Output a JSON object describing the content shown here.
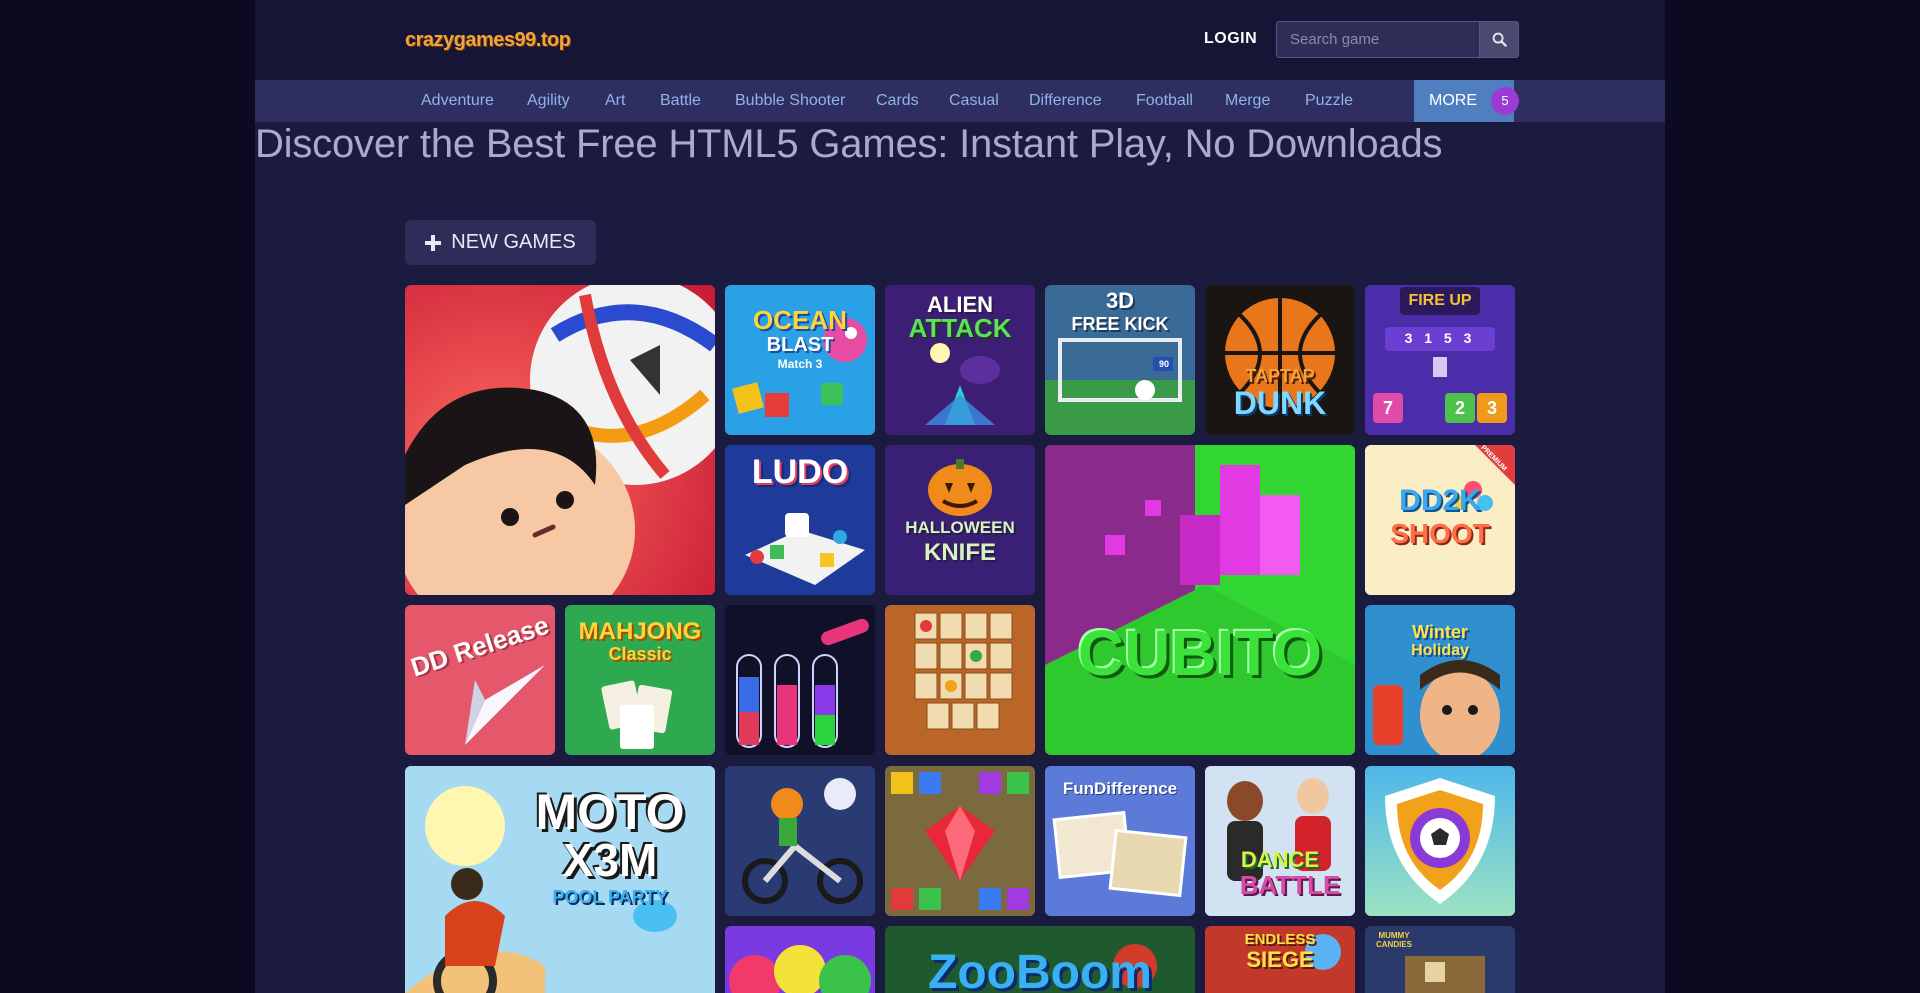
{
  "site": {
    "logo_text": "crazygames99.top"
  },
  "header": {
    "login_label": "LOGIN",
    "search_placeholder": "Search game"
  },
  "nav": {
    "items": [
      "Adventure",
      "Agility",
      "Art",
      "Battle",
      "Bubble Shooter",
      "Cards",
      "Casual",
      "Difference",
      "Football",
      "Merge",
      "Puzzle"
    ],
    "more_label": "MORE",
    "more_count": "5"
  },
  "hero": {
    "title": "Discover the Best Free HTML5 Games: Instant Play, No Downloads"
  },
  "section": {
    "new_games_label": "NEW GAMES"
  },
  "tiles": {
    "ocean_blast": {
      "line1": "OCEAN",
      "line2": "BLAST",
      "line3": "Match 3"
    },
    "alien_attack": {
      "line1": "ALIEN",
      "line2": "ATTACK"
    },
    "free_kick": {
      "line1": "3D",
      "line2": "FREE KICK",
      "score": "90"
    },
    "taptap_dunk": {
      "line1": "TAPTAP",
      "line2": "DUNK"
    },
    "fire_up": {
      "title": "FIRE UP",
      "nums_top": "3 1 5 3",
      "n1": "7",
      "n2": "2",
      "n3": "3"
    },
    "ludo": {
      "title": "LUDO"
    },
    "halloween_knife": {
      "line1": "HALLOWEEN",
      "line2": "KNIFE"
    },
    "cubito": {
      "title": "CUBITO"
    },
    "dd2k_shoot": {
      "line1": "DD2K",
      "line2": "SHOOT",
      "ribbon": "PREMIUM"
    },
    "dd_release": {
      "title": "DD Release"
    },
    "mahjong": {
      "line1": "MAHJONG",
      "line2": "Classic"
    },
    "winter_holiday": {
      "line1": "Winter",
      "line2": "Holiday"
    },
    "moto_x3m": {
      "line1": "MOTO",
      "line2": "X3M",
      "line3": "POOL PARTY"
    },
    "fun_difference": {
      "title": "FunDifference"
    },
    "dance_battle": {
      "line1": "DANCE",
      "line2": "BATTLE"
    },
    "zoo_boom": {
      "title": "ZooBoom"
    },
    "endless_siege": {
      "line1": "ENDLESS",
      "line2": "SIEGE"
    },
    "mummy_candies": {
      "title": "MUMMY CANDIES"
    }
  },
  "colors": {
    "page_bg": "#0c0a21",
    "content_bg": "#1b1a3f",
    "nav_bg": "#2e2e60",
    "nav_link": "#8fb4e8",
    "more_bg": "#4f7fbf",
    "badge_bg": "#9b3bd6"
  },
  "icons": {
    "search_button": "search-icon",
    "new_games": "plus-icon"
  }
}
